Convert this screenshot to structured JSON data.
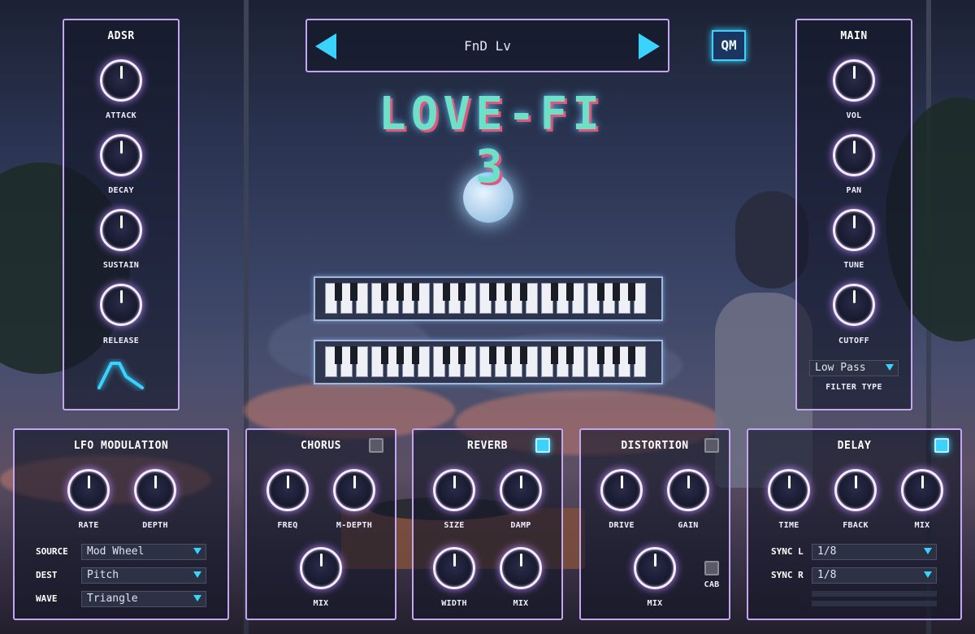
{
  "preset": {
    "name": "FnD Lv"
  },
  "logo": {
    "text": "LOVE-FI 3",
    "badge": "QM"
  },
  "adsr": {
    "title": "ADSR",
    "knobs": [
      "ATTACK",
      "DECAY",
      "SUSTAIN",
      "RELEASE"
    ]
  },
  "main": {
    "title": "MAIN",
    "knobs": [
      "VOL",
      "PAN",
      "TUNE",
      "CUTOFF"
    ],
    "filter_type_value": "Low Pass",
    "filter_type_label": "FILTER TYPE"
  },
  "lfo": {
    "title": "LFO MODULATION",
    "knobs": [
      "RATE",
      "DEPTH"
    ],
    "source_label": "SOURCE",
    "source_value": "Mod Wheel",
    "dest_label": "DEST",
    "dest_value": "Pitch",
    "wave_label": "WAVE",
    "wave_value": "Triangle"
  },
  "chorus": {
    "title": "CHORUS",
    "knobs": [
      "FREQ",
      "M-DEPTH",
      "MIX"
    ],
    "enabled": false
  },
  "reverb": {
    "title": "REVERB",
    "knobs": [
      "SIZE",
      "DAMP",
      "WIDTH",
      "MIX"
    ],
    "enabled": true
  },
  "distortion": {
    "title": "DISTORTION",
    "knobs": [
      "DRIVE",
      "GAIN",
      "MIX"
    ],
    "cab_label": "CAB",
    "enabled": false,
    "cab_enabled": false
  },
  "delay": {
    "title": "DELAY",
    "knobs": [
      "TIME",
      "FBACK",
      "MIX"
    ],
    "enabled": true,
    "sync_l_label": "SYNC L",
    "sync_l_value": "1/8",
    "sync_r_label": "SYNC R",
    "sync_r_value": "1/8"
  },
  "colors": {
    "panel_border": "#c4a6f0",
    "accent": "#3ad2ff",
    "logo_text": "#6fe0c8",
    "logo_shadow": "#e3557a"
  }
}
